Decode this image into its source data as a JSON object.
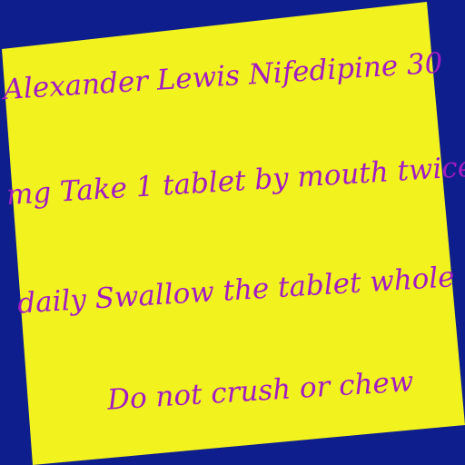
{
  "colors": {
    "background": "#0E1E8C",
    "note": "#F2F21E",
    "ink": "#A21BC2"
  },
  "note": {
    "lines": [
      "Alexander Lewis Nifedipine 30",
      "mg Take 1 tablet by mouth twice",
      "daily Swallow the tablet whole",
      "Do not crush or chew"
    ]
  }
}
